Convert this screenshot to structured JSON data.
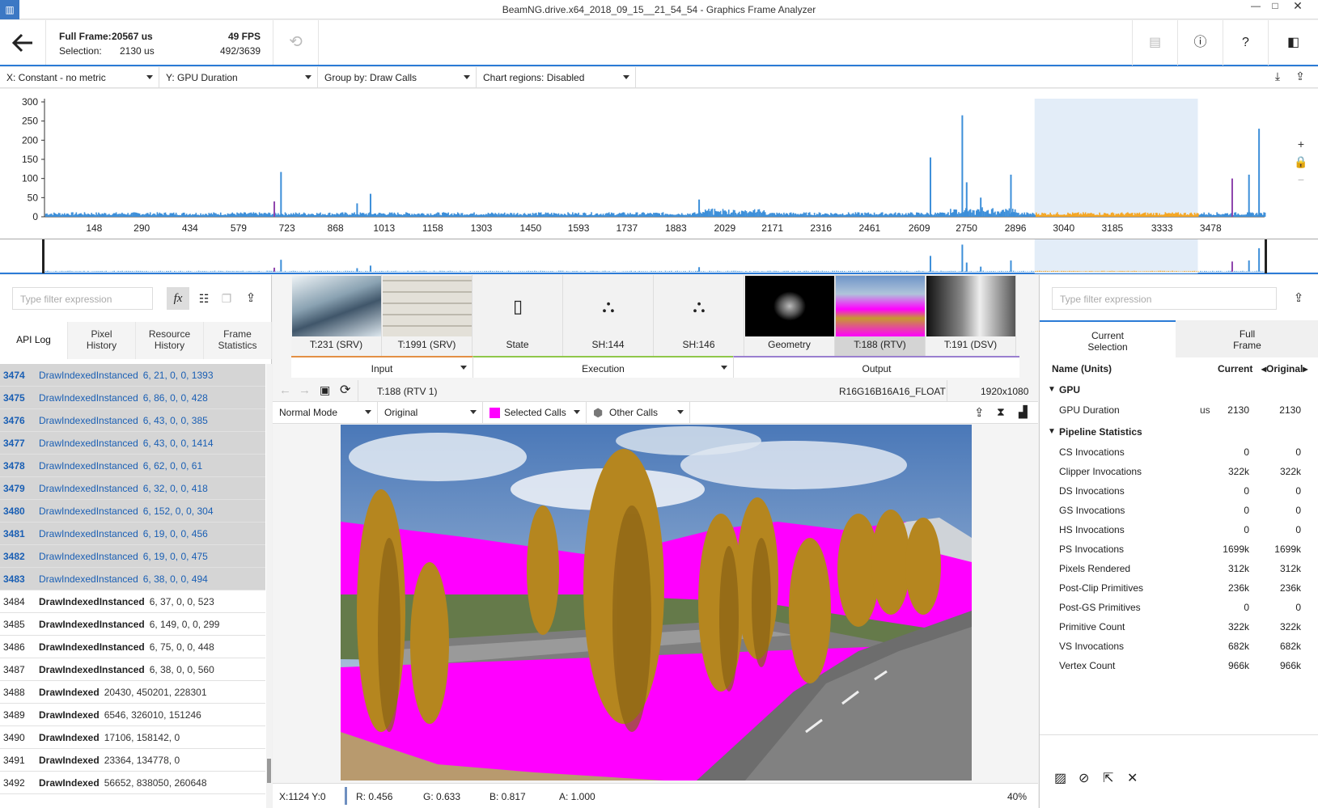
{
  "window": {
    "title": "BeamNG.drive.x64_2018_09_15__21_54_54 - Graphics Frame Analyzer"
  },
  "header": {
    "full_frame_label": "Full Frame:",
    "full_frame_value": "20567 us",
    "selection_label": "Selection:",
    "selection_value": "2130 us",
    "fps": "49 FPS",
    "frame_range": "492/3639"
  },
  "metrics": {
    "x": "X: Constant - no metric",
    "y": "Y: GPU Duration",
    "group": "Group by: Draw Calls",
    "regions": "Chart regions: Disabled"
  },
  "chart_data": {
    "type": "bar",
    "ylim": [
      0,
      300
    ],
    "yticks": [
      0,
      50,
      100,
      150,
      200,
      250,
      300
    ],
    "xlim": [
      0,
      3639
    ],
    "xticks": [
      "148",
      "290",
      "434",
      "579",
      "723",
      "868",
      "1013",
      "1158",
      "1303",
      "1450",
      "1593",
      "1737",
      "1883",
      "2029",
      "2171",
      "2316",
      "2461",
      "2609",
      "2750",
      "2896",
      "3040",
      "3185",
      "3333",
      "3478"
    ],
    "selection_range": [
      2953,
      3440
    ],
    "colors": {
      "default": "#3d8fd9",
      "selected": "#f5a623",
      "highlight": "#8e44ad"
    },
    "peaks": [
      {
        "x": 683,
        "y": 40,
        "c": "highlight"
      },
      {
        "x": 703,
        "y": 117
      },
      {
        "x": 970,
        "y": 60
      },
      {
        "x": 930,
        "y": 35
      },
      {
        "x": 1950,
        "y": 45
      },
      {
        "x": 2640,
        "y": 155
      },
      {
        "x": 2735,
        "y": 265
      },
      {
        "x": 2748,
        "y": 90
      },
      {
        "x": 2790,
        "y": 50
      },
      {
        "x": 2880,
        "y": 110
      },
      {
        "x": 3540,
        "y": 100,
        "c": "highlight"
      },
      {
        "x": 3590,
        "y": 110
      },
      {
        "x": 3620,
        "y": 230
      }
    ]
  },
  "filters": {
    "left_placeholder": "Type filter expression",
    "right_placeholder": "Type filter expression"
  },
  "left_tabs": [
    "API Log",
    "Pixel\nHistory",
    "Resource\nHistory",
    "Frame\nStatistics"
  ],
  "api_rows": [
    {
      "n": "3474",
      "f": "DrawIndexedInstanced",
      "a": "6, 21, 0, 0, 1393",
      "sel": true
    },
    {
      "n": "3475",
      "f": "DrawIndexedInstanced",
      "a": "6, 86, 0, 0, 428",
      "sel": true
    },
    {
      "n": "3476",
      "f": "DrawIndexedInstanced",
      "a": "6, 43, 0, 0, 385",
      "sel": true
    },
    {
      "n": "3477",
      "f": "DrawIndexedInstanced",
      "a": "6, 43, 0, 0, 1414",
      "sel": true
    },
    {
      "n": "3478",
      "f": "DrawIndexedInstanced",
      "a": "6, 62, 0, 0, 61",
      "sel": true
    },
    {
      "n": "3479",
      "f": "DrawIndexedInstanced",
      "a": "6, 32, 0, 0, 418",
      "sel": true
    },
    {
      "n": "3480",
      "f": "DrawIndexedInstanced",
      "a": "6, 152, 0, 0, 304",
      "sel": true
    },
    {
      "n": "3481",
      "f": "DrawIndexedInstanced",
      "a": "6, 19, 0, 0, 456",
      "sel": true
    },
    {
      "n": "3482",
      "f": "DrawIndexedInstanced",
      "a": "6, 19, 0, 0, 475",
      "sel": true
    },
    {
      "n": "3483",
      "f": "DrawIndexedInstanced",
      "a": "6, 38, 0, 0, 494",
      "sel": true
    },
    {
      "n": "3484",
      "f": "DrawIndexedInstanced",
      "a": "6, 37, 0, 0, 523",
      "sel": false
    },
    {
      "n": "3485",
      "f": "DrawIndexedInstanced",
      "a": "6, 149, 0, 0, 299",
      "sel": false
    },
    {
      "n": "3486",
      "f": "DrawIndexedInstanced",
      "a": "6, 75, 0, 0, 448",
      "sel": false
    },
    {
      "n": "3487",
      "f": "DrawIndexedInstanced",
      "a": "6, 38, 0, 0, 560",
      "sel": false
    },
    {
      "n": "3488",
      "f": "DrawIndexed",
      "a": "20430, 450201, 228301",
      "sel": false
    },
    {
      "n": "3489",
      "f": "DrawIndexed",
      "a": "6546, 326010, 151246",
      "sel": false
    },
    {
      "n": "3490",
      "f": "DrawIndexed",
      "a": "17106, 158142, 0",
      "sel": false
    },
    {
      "n": "3491",
      "f": "DrawIndexed",
      "a": "23364, 134778, 0",
      "sel": false
    },
    {
      "n": "3492",
      "f": "DrawIndexed",
      "a": "56652, 838050, 260648",
      "sel": false
    }
  ],
  "thumbs": [
    {
      "cap": "T:231 (SRV)",
      "kind": "snow"
    },
    {
      "cap": "T:1991 (SRV)",
      "kind": "brick"
    },
    {
      "cap": "State",
      "kind": "state"
    },
    {
      "cap": "SH:144",
      "kind": "shader"
    },
    {
      "cap": "SH:146",
      "kind": "shader"
    },
    {
      "cap": "Geometry",
      "kind": "geometry"
    },
    {
      "cap": "T:188 (RTV)",
      "kind": "rtv"
    },
    {
      "cap": "T:191 (DSV)",
      "kind": "dsv"
    }
  ],
  "groups": {
    "input": "Input",
    "execution": "Execution",
    "output": "Output"
  },
  "view": {
    "target": "T:188 (RTV 1)",
    "format": "R16G16B16A16_FLOAT",
    "resolution": "1920x1080",
    "mode": "Normal Mode",
    "channel": "Original",
    "selected_calls": "Selected Calls",
    "other_calls": "Other Calls"
  },
  "status": {
    "coord": "X:1124 Y:0",
    "r": "R: 0.456",
    "g": "G: 0.633",
    "b": "B: 0.817",
    "a": "A: 1.000",
    "zoom": "40%"
  },
  "right_tabs": {
    "current": "Current\nSelection",
    "full": "Full\nFrame"
  },
  "stats_header": {
    "name": "Name (Units)",
    "current": "Current",
    "original": "Original"
  },
  "gpu": {
    "title": "GPU",
    "rows": [
      {
        "n": "GPU Duration",
        "u": "us",
        "c": "2130",
        "o": "2130"
      }
    ]
  },
  "pipeline": {
    "title": "Pipeline Statistics",
    "rows": [
      {
        "n": "CS Invocations",
        "c": "0",
        "o": "0"
      },
      {
        "n": "Clipper Invocations",
        "c": "322k",
        "o": "322k"
      },
      {
        "n": "DS Invocations",
        "c": "0",
        "o": "0"
      },
      {
        "n": "GS Invocations",
        "c": "0",
        "o": "0"
      },
      {
        "n": "HS Invocations",
        "c": "0",
        "o": "0"
      },
      {
        "n": "PS Invocations",
        "c": "1699k",
        "o": "1699k"
      },
      {
        "n": "Pixels Rendered",
        "c": "312k",
        "o": "312k"
      },
      {
        "n": "Post-Clip Primitives",
        "c": "236k",
        "o": "236k"
      },
      {
        "n": "Post-GS Primitives",
        "c": "0",
        "o": "0"
      },
      {
        "n": "Primitive Count",
        "c": "322k",
        "o": "322k"
      },
      {
        "n": "VS Invocations",
        "c": "682k",
        "o": "682k"
      },
      {
        "n": "Vertex Count",
        "c": "966k",
        "o": "966k"
      }
    ]
  },
  "icons": {
    "back": "back-arrow-icon",
    "undo": "undo-icon",
    "fx": "fx-icon",
    "export": "export-icon"
  }
}
